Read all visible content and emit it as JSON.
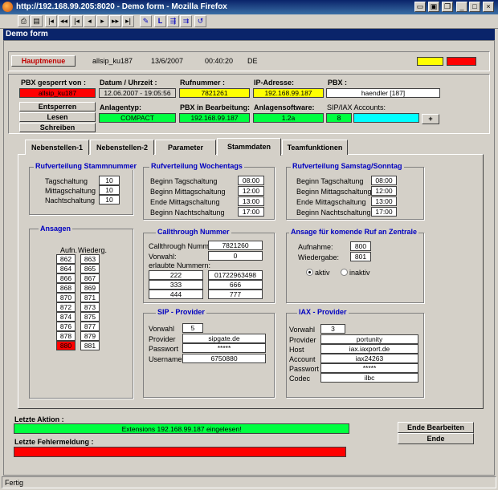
{
  "window": {
    "title": "http://192.168.99.205:8020 - Demo form - Mozilla Firefox",
    "app_title": "Demo form"
  },
  "toolbar": {
    "buttons": [
      "print",
      "save",
      "first",
      "prev-page",
      "prev",
      "next",
      "next-page",
      "last",
      "edit",
      "L",
      "export",
      "import",
      "refresh"
    ]
  },
  "header": {
    "menu_button": "Hauptmenue",
    "user": "allsip_ku187",
    "date": "13/6/2007",
    "time": "00:40:20",
    "lang": "DE",
    "indicator_colors": [
      "#ffff00",
      "#ff0000"
    ]
  },
  "pbx": {
    "locked_by_label": "PBX gesperrt von :",
    "locked_by": "allsip_ku187",
    "datetime_label": "Datum / Uhrzeit :",
    "datetime": "12.06.2007 - 19:05:56",
    "number_label": "Rufnummer :",
    "number": "7821261",
    "ip_label": "IP-Adresse:",
    "ip": "192.168.99.187",
    "pbx_label": "PBX :",
    "pbx": "haendler [187]",
    "unlock_btn": "Entsperren",
    "read_btn": "Lesen",
    "write_btn": "Schreiben",
    "type_label": "Anlagentyp:",
    "type": "COMPACT",
    "editing_label": "PBX in Bearbeitung:",
    "editing": "192.168.99.187",
    "software_label": "Anlagensoftware:",
    "software": "1.2a",
    "accounts_label": "SIP/IAX Accounts:",
    "accounts": "8",
    "plus_btn": "+"
  },
  "tabs": [
    "Nebenstellen-1",
    "Nebenstellen-2",
    "Parameter",
    "Stammdaten",
    "Teamfunktionen"
  ],
  "rv_stamm": {
    "title": "Rufverteilung Stammnummer",
    "rows": [
      {
        "label": "Tagschaltung",
        "value": "10"
      },
      {
        "label": "Mittagschaltung",
        "value": "10"
      },
      {
        "label": "Nachtschaltung",
        "value": "10"
      }
    ]
  },
  "rv_wochentags": {
    "title": "Rufverteilung Wochentags",
    "rows": [
      {
        "label": "Beginn Tagschaltung",
        "value": "08:00"
      },
      {
        "label": "Beginn Mittagschaltung",
        "value": "12:00"
      },
      {
        "label": "Ende Mittagschaltung",
        "value": "13:00"
      },
      {
        "label": "Beginn Nachtschaltung",
        "value": "17:00"
      }
    ]
  },
  "rv_wochenende": {
    "title": "Rufverteilung Samstag/Sonntag",
    "rows": [
      {
        "label": "Beginn Tagschaltung",
        "value": "08:00"
      },
      {
        "label": "Beginn Mittagschaltung",
        "value": "12:00"
      },
      {
        "label": "Ende Mittagschaltung",
        "value": "13:00"
      },
      {
        "label": "Beginn Nachtschaltung",
        "value": "17:00"
      }
    ]
  },
  "ansagen": {
    "title": "Ansagen",
    "col_rec": "Aufn.",
    "col_play": "Wiederg.",
    "rows": [
      [
        "862",
        "863"
      ],
      [
        "864",
        "865"
      ],
      [
        "866",
        "867"
      ],
      [
        "868",
        "869"
      ],
      [
        "870",
        "871"
      ],
      [
        "872",
        "873"
      ],
      [
        "874",
        "875"
      ],
      [
        "876",
        "877"
      ],
      [
        "878",
        "879"
      ],
      [
        "880",
        "881"
      ]
    ],
    "highlight_color": "#ff0000"
  },
  "callthrough": {
    "title": "Callthrough Nummer",
    "number_label": "Callthrough Nummer:",
    "number": "7821260",
    "prefix_label": "Vorwahl:",
    "prefix": "0",
    "allowed_label": "erlaubte Nummern:",
    "allowed": [
      [
        "222",
        "01722963498"
      ],
      [
        "333",
        "666"
      ],
      [
        "444",
        "777"
      ]
    ]
  },
  "ansage_zentrale": {
    "title": "Ansage für komende Ruf an Zentrale",
    "rec_label": "Aufnahme:",
    "rec": "800",
    "play_label": "Wiedergabe:",
    "play": "801",
    "active_label": "aktiv",
    "inactive_label": "inaktiv"
  },
  "sip": {
    "title": "SIP - Provider",
    "prefix_label": "Vorwahl",
    "prefix": "5",
    "provider_label": "Provider",
    "provider": "sipgate.de",
    "password_label": "Passwort",
    "password": "*****",
    "username_label": "Username",
    "username": "6750880"
  },
  "iax": {
    "title": "IAX - Provider",
    "prefix_label": "Vorwahl",
    "prefix": "3",
    "provider_label": "Provider",
    "provider": "portunity",
    "host_label": "Host",
    "host": "iax.iaxport.de",
    "account_label": "Account",
    "account": "iax24263",
    "password_label": "Passwort",
    "password": "*****",
    "codec_label": "Codec",
    "codec": "ilbc"
  },
  "footer": {
    "last_action_label": "Letzte Aktion :",
    "last_action": "Extensions 192.168.99.187 eingelesen!",
    "last_error_label": "Letzte Fehlermeldung :",
    "last_error": "",
    "end_edit_btn": "Ende Bearbeiten",
    "end_btn": "Ende"
  },
  "status": {
    "text": "Fertig"
  },
  "colors": {
    "green": "#00ff40",
    "yellow": "#ffff00",
    "red": "#ff0000",
    "cyan": "#00ffff",
    "title_blue": "#0000c0"
  }
}
